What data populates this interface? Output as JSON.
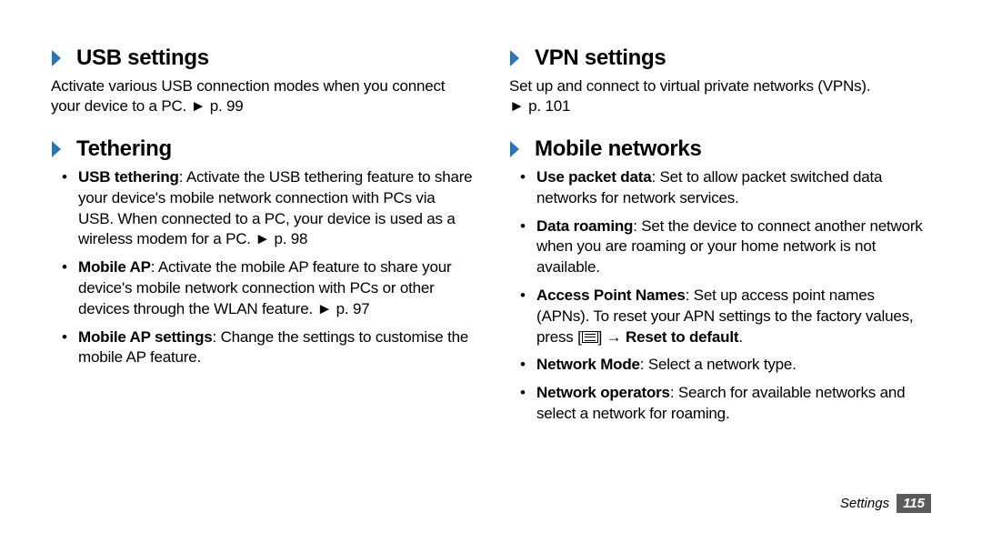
{
  "left": {
    "usb": {
      "title": "USB settings",
      "desc": "Activate various USB connection modes when you connect your device to a PC. ► p. 99"
    },
    "tethering": {
      "title": "Tethering",
      "items": [
        {
          "term": "USB tethering",
          "text": ": Activate the USB tethering feature to share your device's mobile network connection with PCs via USB. When connected to a PC, your device is used as a wireless modem for a PC. ► p. 98"
        },
        {
          "term": "Mobile AP",
          "text": ": Activate the mobile AP feature to share your device's mobile network connection with PCs or other devices through the WLAN feature. ► p. 97"
        },
        {
          "term": "Mobile AP settings",
          "text": ": Change the settings to customise the mobile AP feature."
        }
      ]
    }
  },
  "right": {
    "vpn": {
      "title": "VPN settings",
      "desc_pre": "Set up and connect to virtual private networks (VPNs).",
      "desc_ref": "► p. 101"
    },
    "mobile": {
      "title": "Mobile networks",
      "items": [
        {
          "term": "Use packet data",
          "text": ": Set to allow packet switched data networks for network services."
        },
        {
          "term": "Data roaming",
          "text": ": Set the device to connect another network when you are roaming or your home network is not available."
        },
        {
          "term": "Access Point Names",
          "text_pre": ": Set up access point names (APNs). To reset your APN settings to the factory values, press [",
          "text_mid_icon": true,
          "text_post_arrow": "] → ",
          "bold_tail": "Reset to default",
          "tail_end": "."
        },
        {
          "term": "Network Mode",
          "text": ": Select a network type."
        },
        {
          "term": "Network operators",
          "text": ": Search for available networks and select a network for roaming."
        }
      ]
    }
  },
  "footer": {
    "label": "Settings",
    "page": "115"
  }
}
